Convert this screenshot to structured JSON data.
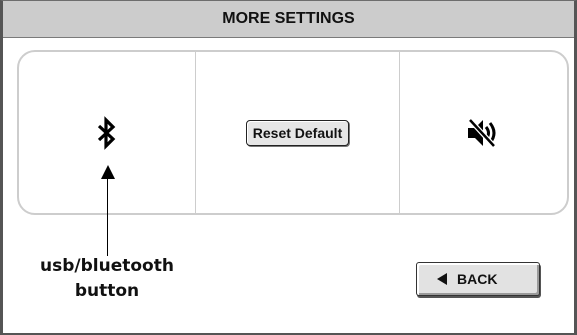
{
  "header": {
    "title": "MORE SETTINGS"
  },
  "settings_panel": {
    "bluetooth": {
      "icon": "bluetooth-icon"
    },
    "reset": {
      "label": "Reset Default"
    },
    "sound": {
      "icon": "speaker-muted-icon"
    }
  },
  "annotation": {
    "line1": "usb/bluetooth",
    "line2": "button"
  },
  "footer": {
    "back_label": "BACK",
    "back_icon": "left-triangle-icon"
  }
}
